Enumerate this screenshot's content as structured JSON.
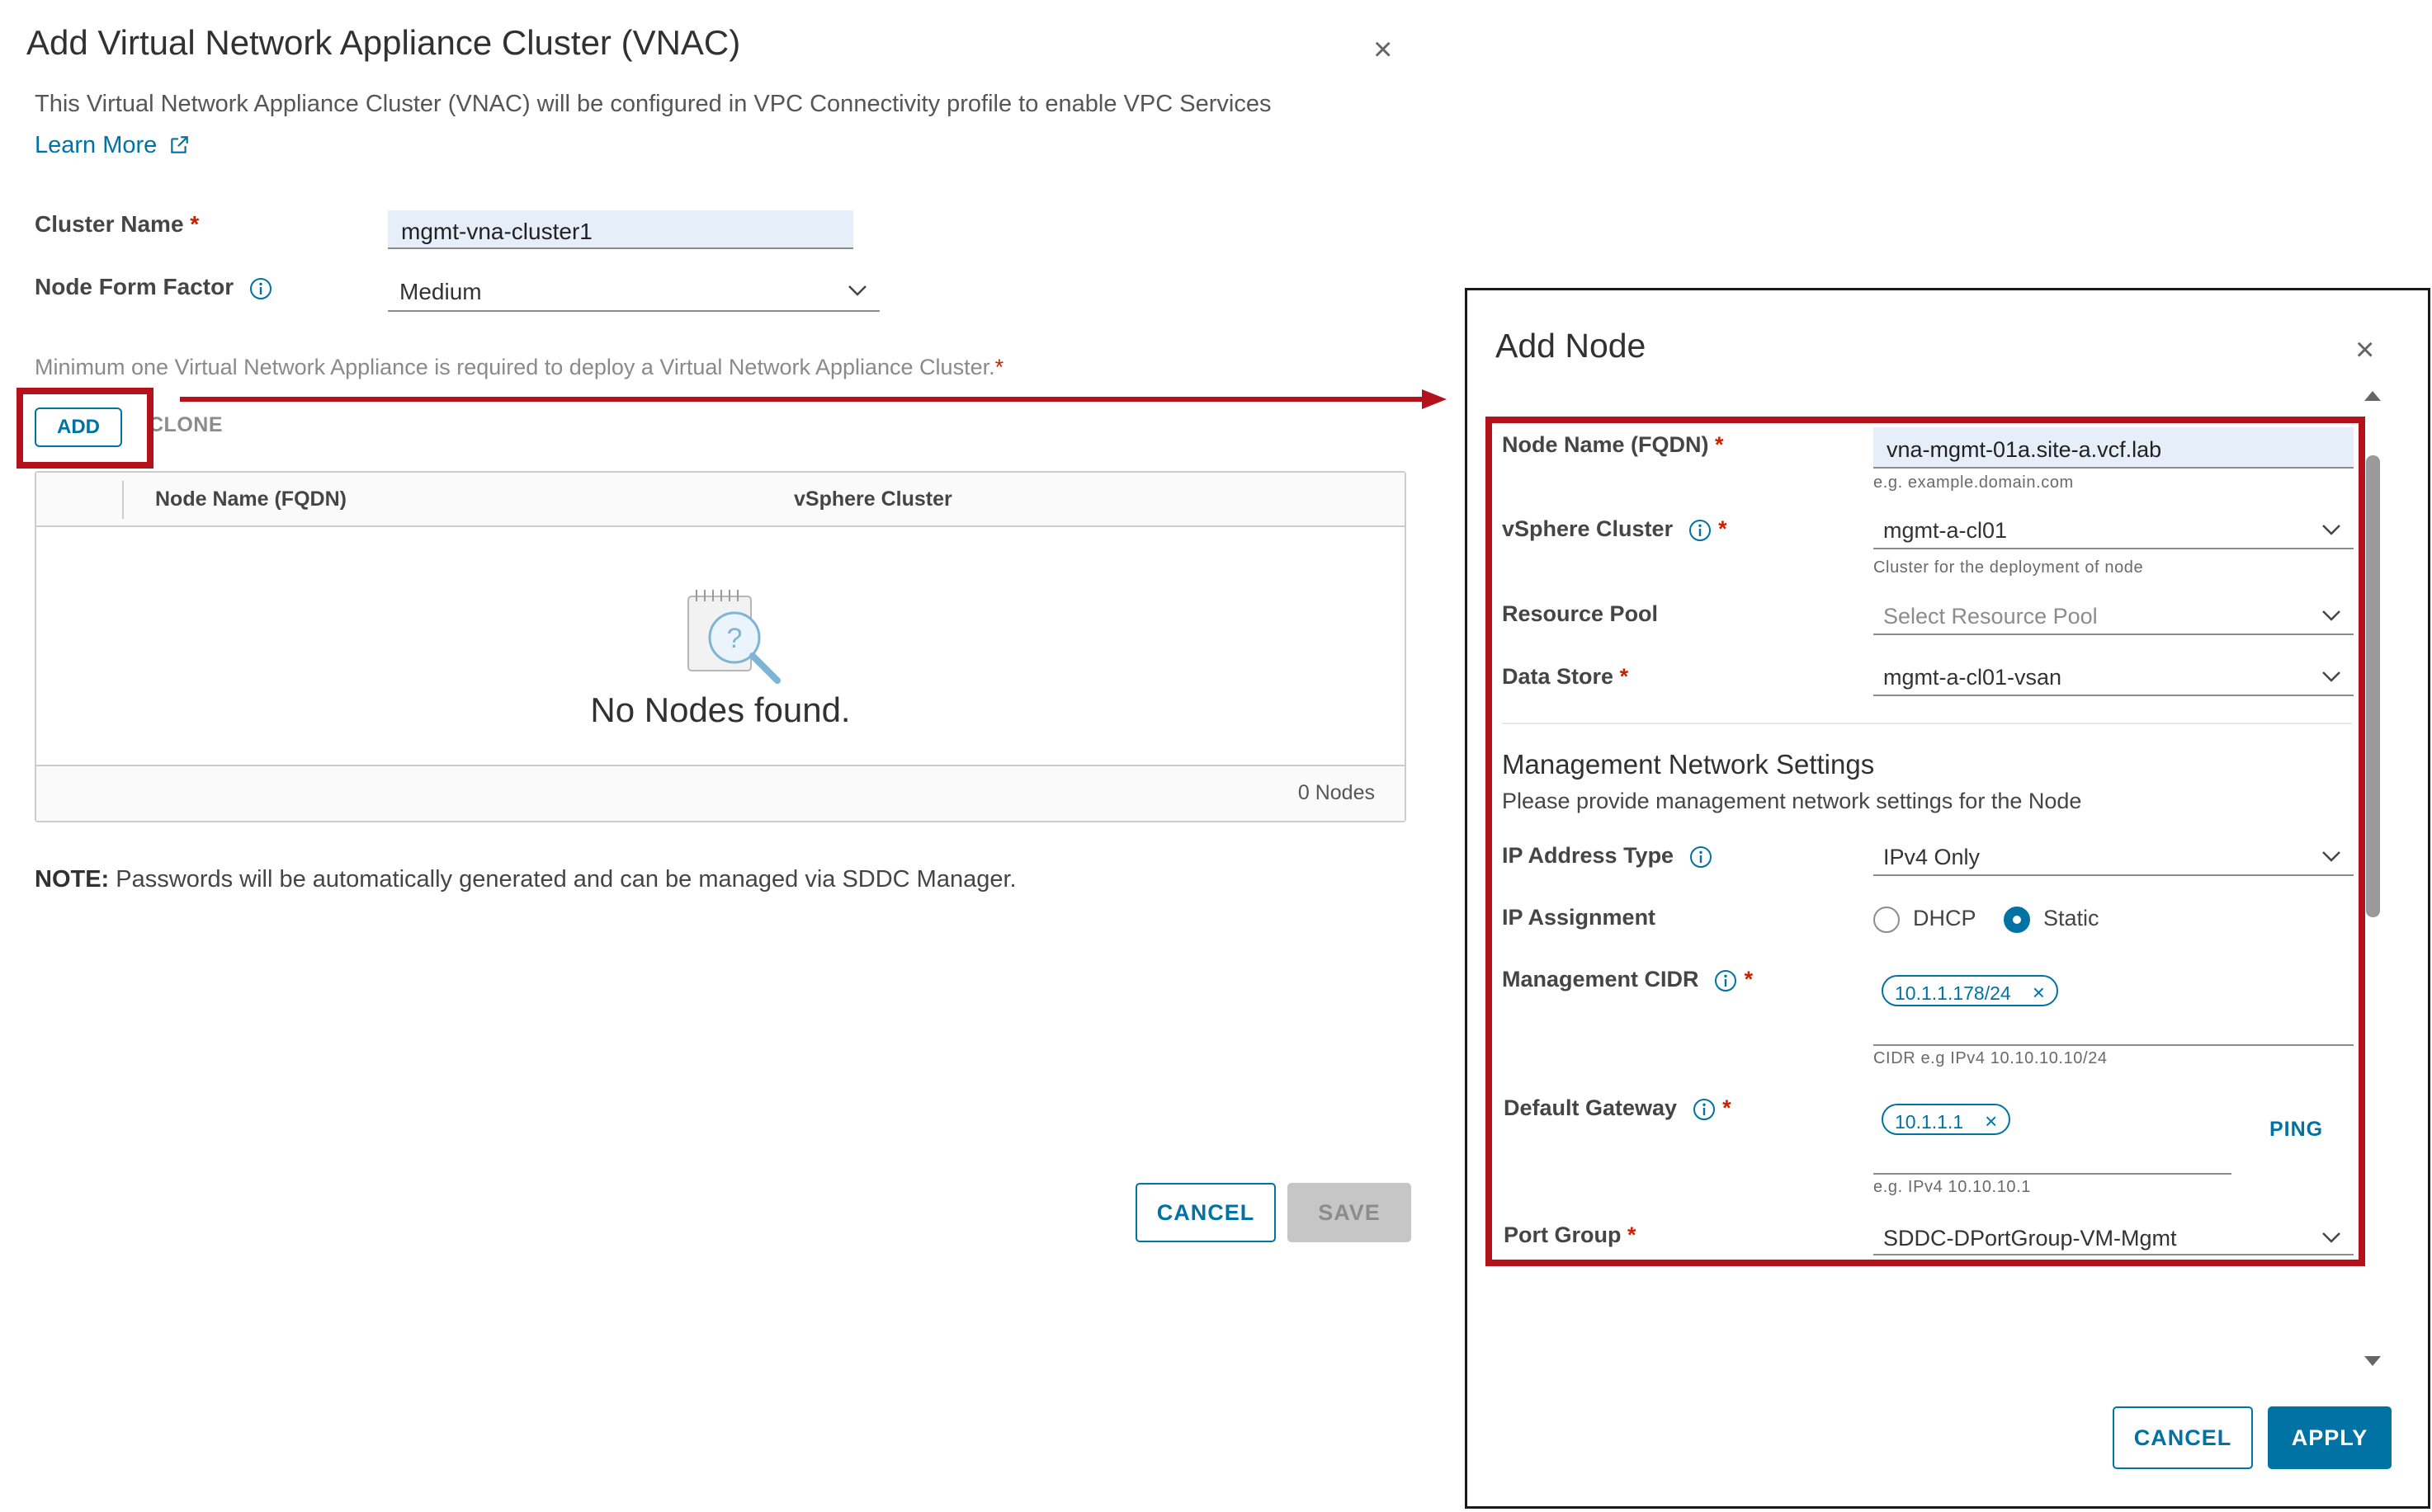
{
  "vnac_dialog": {
    "title": "Add Virtual Network Appliance Cluster (VNAC)",
    "description": "This Virtual Network Appliance Cluster (VNAC) will be configured in VPC Connectivity profile to enable VPC Services",
    "learn_more": "Learn More",
    "cluster_name": {
      "label": "Cluster Name",
      "value": "mgmt-vna-cluster1"
    },
    "node_form_factor": {
      "label": "Node Form Factor",
      "value": "Medium"
    },
    "min_note": "Minimum one Virtual Network Appliance is required to deploy a Virtual Network Appliance Cluster.",
    "add_label": "ADD",
    "clone_label": "CLONE",
    "table": {
      "columns": [
        "Node Name (FQDN)",
        "vSphere Cluster"
      ],
      "empty_text": "No Nodes found.",
      "footer_count": "0 Nodes"
    },
    "note_prefix": "NOTE:",
    "note_text": " Passwords will be automatically generated and can be managed via SDDC Manager.",
    "cancel_label": "CANCEL",
    "save_label": "SAVE"
  },
  "add_node_dialog": {
    "title": "Add Node",
    "node_name": {
      "label": "Node Name (FQDN)",
      "value": "vna-mgmt-01a.site-a.vcf.lab",
      "helper": "e.g. example.domain.com"
    },
    "vsphere_cluster": {
      "label": "vSphere Cluster",
      "value": "mgmt-a-cl01",
      "helper": "Cluster for the deployment of node"
    },
    "resource_pool": {
      "label": "Resource Pool",
      "placeholder": "Select Resource Pool"
    },
    "data_store": {
      "label": "Data Store",
      "value": "mgmt-a-cl01-vsan"
    },
    "mgmt_section": {
      "title": "Management Network Settings",
      "description": "Please provide management network settings for the Node"
    },
    "ip_address_type": {
      "label": "IP Address Type",
      "value": "IPv4 Only"
    },
    "ip_assignment": {
      "label": "IP Assignment",
      "options": [
        "DHCP",
        "Static"
      ],
      "selected": "Static"
    },
    "management_cidr": {
      "label": "Management CIDR",
      "chip": "10.1.1.178/24",
      "helper": "CIDR e.g IPv4 10.10.10.10/24"
    },
    "default_gateway": {
      "label": "Default Gateway",
      "chip": "10.1.1.1",
      "helper": "e.g. IPv4 10.10.10.1",
      "ping_label": "PING"
    },
    "port_group": {
      "label": "Port Group",
      "value": "SDDC-DPortGroup-VM-Mgmt"
    },
    "cancel_label": "CANCEL",
    "apply_label": "APPLY"
  },
  "colors": {
    "accent": "#0072a3",
    "highlight": "#b3121d",
    "required": "#c92100"
  },
  "icons": [
    "close-icon",
    "external-link-icon",
    "info-icon",
    "chevron-down-icon",
    "empty-search-icon",
    "scroll-up-icon",
    "scroll-down-icon",
    "remove-chip-icon"
  ]
}
